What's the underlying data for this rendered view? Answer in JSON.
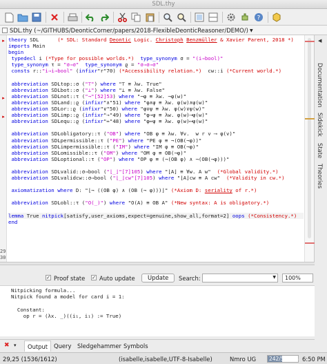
{
  "window": {
    "title": "SDL.thy"
  },
  "file": {
    "path": "SDL.thy (~/GITHUBS/DeonticCorner/papers/2018-FlexibleDeonticReasoner/DEMO/)"
  },
  "code_lines": [
    [
      {
        "t": "theory",
        "c": "kw"
      },
      {
        "t": " SDL      "
      },
      {
        "t": "(* SDL: Standard ",
        "c": "red"
      },
      {
        "t": "Deontic",
        "c": "red ul"
      },
      {
        "t": " Logic. ",
        "c": "red"
      },
      {
        "t": "Christoph",
        "c": "red ul"
      },
      {
        "t": " ",
        "c": "red"
      },
      {
        "t": "Benzmüller",
        "c": "red ul"
      },
      {
        "t": " & Xavier Parent, 2018 *)",
        "c": "red"
      }
    ],
    [
      {
        "t": "imports",
        "c": "kw"
      },
      {
        "t": " Main"
      }
    ],
    [
      {
        "t": "begin",
        "c": "kw"
      }
    ],
    [
      {
        "t": " typedecl",
        "c": "kw"
      },
      {
        "t": " i "
      },
      {
        "t": "(*Type for possible worlds.*)",
        "c": "red"
      },
      {
        "t": "  "
      },
      {
        "t": "type_synonym",
        "c": "kw"
      },
      {
        "t": " σ = "
      },
      {
        "t": "\"(i⇒bool)\"",
        "c": "str"
      }
    ],
    [
      {
        "t": " type_synonym",
        "c": "kw"
      },
      {
        "t": " τ = "
      },
      {
        "t": "\"σ⇒σ\"",
        "c": "str"
      },
      {
        "t": "  "
      },
      {
        "t": "type_synonym",
        "c": "kw"
      },
      {
        "t": " ϱ = "
      },
      {
        "t": "\"σ⇒σ⇒σ\"",
        "c": "str"
      }
    ],
    [
      {
        "t": " consts",
        "c": "kw"
      },
      {
        "t": " r::"
      },
      {
        "t": "\"i⇒i⇒bool\"",
        "c": "str"
      },
      {
        "t": " ("
      },
      {
        "t": "infixr",
        "c": "kw"
      },
      {
        "t": "\"r\"70) "
      },
      {
        "t": "(*Accessibility relation.*)",
        "c": "red"
      },
      {
        "t": "  cw::i "
      },
      {
        "t": "(*Current world.*)",
        "c": "red"
      }
    ],
    [
      {
        "t": ""
      }
    ],
    [
      {
        "t": " abbreviation",
        "c": "kw"
      },
      {
        "t": " SDLtop::σ ("
      },
      {
        "t": "\"⊤\"",
        "c": "str"
      },
      {
        "t": ") "
      },
      {
        "t": "where",
        "c": "kw"
      },
      {
        "t": " \"⊤ ≡ λw. True\""
      }
    ],
    [
      {
        "t": " abbreviation",
        "c": "kw"
      },
      {
        "t": " SDLbot::σ ("
      },
      {
        "t": "\"⊥\"",
        "c": "str"
      },
      {
        "t": ") "
      },
      {
        "t": "where",
        "c": "kw"
      },
      {
        "t": " \"⊥ ≡ λw. False\""
      }
    ],
    [
      {
        "t": " abbreviation",
        "c": "kw"
      },
      {
        "t": " SDLnot::τ ("
      },
      {
        "t": "\"¬\"[52]53",
        "c": "str"
      },
      {
        "t": ") "
      },
      {
        "t": "where",
        "c": "kw"
      },
      {
        "t": " \"¬φ ≡ λw. ¬φ(w)\""
      }
    ],
    [
      {
        "t": " abbreviation",
        "c": "kw"
      },
      {
        "t": " SDLand::ϱ ("
      },
      {
        "t": "infixr",
        "c": "kw"
      },
      {
        "t": "\"∧\"51) "
      },
      {
        "t": "where",
        "c": "kw"
      },
      {
        "t": " \"φ∧ψ ≡ λw. φ(w)∧ψ(w)\""
      }
    ],
    [
      {
        "t": " abbreviation",
        "c": "kw"
      },
      {
        "t": " SDLor::ϱ ("
      },
      {
        "t": "infixr",
        "c": "kw"
      },
      {
        "t": "\"∨\"50) "
      },
      {
        "t": "where",
        "c": "kw"
      },
      {
        "t": " \"φ∨ψ ≡ λw. φ(w)∨ψ(w)\""
      }
    ],
    [
      {
        "t": " abbreviation",
        "c": "kw"
      },
      {
        "t": " SDLimp::ϱ ("
      },
      {
        "t": "infixr",
        "c": "kw"
      },
      {
        "t": "\"→\"49) "
      },
      {
        "t": "where",
        "c": "kw"
      },
      {
        "t": " \"φ→ψ ≡ λw. φ(w)⟶ψ(w)\""
      }
    ],
    [
      {
        "t": " abbreviation",
        "c": "kw"
      },
      {
        "t": " SDLequ::ϱ ("
      },
      {
        "t": "infixr",
        "c": "kw"
      },
      {
        "t": "\"↔\"48) "
      },
      {
        "t": "where",
        "c": "kw"
      },
      {
        "t": " \"φ↔ψ ≡ λw. φ(w)⟷ψ(w)\""
      }
    ],
    [
      {
        "t": ""
      }
    ],
    [
      {
        "t": " abbreviation",
        "c": "kw"
      },
      {
        "t": " SDLobligatory::τ ("
      },
      {
        "t": "\"OB\"",
        "c": "str"
      },
      {
        "t": ") "
      },
      {
        "t": "where",
        "c": "kw"
      },
      {
        "t": " \"OB φ ≡ λw. ∀v.  w r v ⟶ φ(v)\""
      }
    ],
    [
      {
        "t": " abbreviation",
        "c": "kw"
      },
      {
        "t": " SDLpermissible::τ ("
      },
      {
        "t": "\"PE\"",
        "c": "str"
      },
      {
        "t": ") "
      },
      {
        "t": "where",
        "c": "kw"
      },
      {
        "t": " \"PE φ ≡ ¬(OB(¬φ))\""
      }
    ],
    [
      {
        "t": " abbreviation",
        "c": "kw"
      },
      {
        "t": " SDLimpermissible::τ ("
      },
      {
        "t": "\"IM\"",
        "c": "str"
      },
      {
        "t": ") "
      },
      {
        "t": "where",
        "c": "kw"
      },
      {
        "t": " \"IM φ ≡ OB(¬φ)\""
      }
    ],
    [
      {
        "t": " abbreviation",
        "c": "kw"
      },
      {
        "t": " SDLomissible::τ ("
      },
      {
        "t": "\"OM\"",
        "c": "str"
      },
      {
        "t": ") "
      },
      {
        "t": "where",
        "c": "kw"
      },
      {
        "t": " \"OM φ ≡ OB(¬φ)\""
      }
    ],
    [
      {
        "t": " abbreviation",
        "c": "kw"
      },
      {
        "t": " SDLoptional::τ ("
      },
      {
        "t": "\"OP\"",
        "c": "str"
      },
      {
        "t": ") "
      },
      {
        "t": "where",
        "c": "kw"
      },
      {
        "t": " \"OP φ ≡ (¬(OB φ) ∧ ¬(OB(¬φ)))\""
      }
    ],
    [
      {
        "t": ""
      }
    ],
    [
      {
        "t": " abbreviation",
        "c": "kw"
      },
      {
        "t": " SDLvalid::σ⇒bool ("
      },
      {
        "t": "\"⌊_⌋\"[7]105",
        "c": "str"
      },
      {
        "t": ") "
      },
      {
        "t": "where",
        "c": "kw"
      },
      {
        "t": " \"⌊A⌋ ≡ ∀w. A w\"  "
      },
      {
        "t": "(*Global validity.*)",
        "c": "red"
      }
    ],
    [
      {
        "t": " abbreviation",
        "c": "kw"
      },
      {
        "t": " SDLvalidcw::σ⇒bool ("
      },
      {
        "t": "\"⌊_⌋cw\"[7]105",
        "c": "str"
      },
      {
        "t": ") "
      },
      {
        "t": "where",
        "c": "kw"
      },
      {
        "t": " \"⌊A⌋cw ≡ A cw\"  "
      },
      {
        "t": "(*Validity in cw.*)",
        "c": "red"
      }
    ],
    [
      {
        "t": ""
      }
    ],
    [
      {
        "t": " axiomatization",
        "c": "kw"
      },
      {
        "t": " "
      },
      {
        "t": "where",
        "c": "kw"
      },
      {
        "t": " D: \"⌊¬ ((OB φ) ∧ (OB (¬ φ)))⌋\" "
      },
      {
        "t": "(*Axiom D: ",
        "c": "red"
      },
      {
        "t": "seriality",
        "c": "red ul"
      },
      {
        "t": " of r.*)",
        "c": "red"
      }
    ],
    [
      {
        "t": ""
      }
    ],
    [
      {
        "t": " abbreviation",
        "c": "kw"
      },
      {
        "t": " SDLobl::τ ("
      },
      {
        "t": "\"O(_)\"",
        "c": "str"
      },
      {
        "t": ") "
      },
      {
        "t": "where",
        "c": "kw"
      },
      {
        "t": " \"O(A) ≡ OB A\" "
      },
      {
        "t": "(*New syntax: A is obligatory.*)",
        "c": "red"
      }
    ],
    [
      {
        "t": ""
      }
    ],
    [
      {
        "t": "lemma",
        "c": "kw"
      },
      {
        "t": " True "
      },
      {
        "t": "nitpick",
        "c": "kw"
      },
      {
        "t": "[satisfy,user_axioms,expect=genuine,show_all,format=2] "
      },
      {
        "t": "oops",
        "c": "kw"
      },
      {
        "t": " "
      },
      {
        "t": "(*Consistency.*)",
        "c": "red"
      }
    ],
    [
      {
        "t": "end",
        "c": "kw"
      }
    ]
  ],
  "gutter_numbers": {
    "line29": "29",
    "line30": "30"
  },
  "output_controls": {
    "proof_state_label": "Proof state",
    "auto_update_label": "Auto update",
    "update_button": "Update",
    "search_label": "Search:",
    "search_value": "",
    "zoom_value": "100%",
    "proof_state_checked": true,
    "auto_update_checked": true
  },
  "output_lines": [
    "Nitpicking formula...",
    "Nitpick found a model for card i = 1:",
    "",
    "  Constant:",
    "    op r = (λx. _)((i₁, i₁) := True)"
  ],
  "bottom_tabs": [
    "Output",
    "Query",
    "Sledgehammer",
    "Symbols"
  ],
  "side_tabs": [
    "Documentation",
    "Sidekick",
    "State",
    "Theories"
  ],
  "status": {
    "position": "29,25 (1536/1612)",
    "mode": "(isabelle,isabelle,UTF-8-Isabelle)",
    "flags": "Nmro UG",
    "memory": "242/517MB",
    "memory_fraction": 0.47,
    "time": "6:50 PM"
  },
  "colors": {
    "keyword": "#0000e0",
    "string": "#c800c8",
    "comment": "#d10000",
    "error": "#d10000"
  }
}
